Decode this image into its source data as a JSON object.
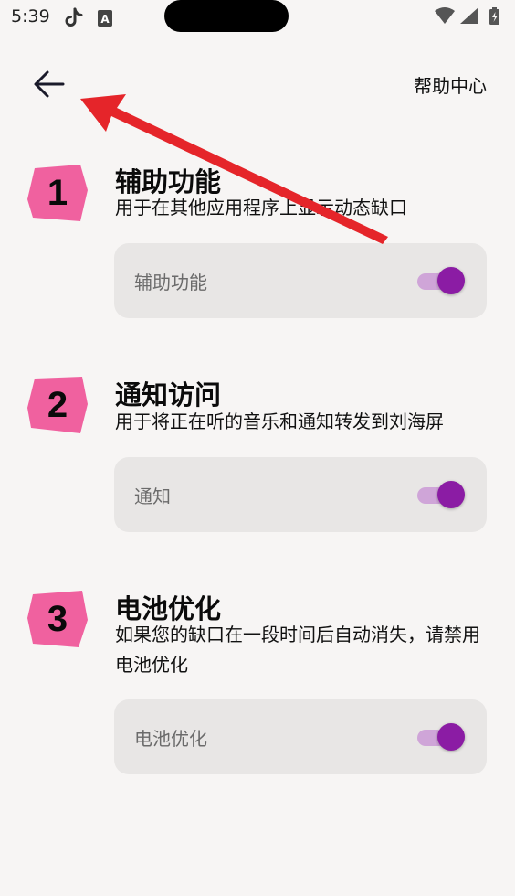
{
  "status_bar": {
    "time": "5:39",
    "icons": [
      "tiktok-icon",
      "a-box-icon",
      "wifi-icon",
      "signal-icon",
      "battery-icon"
    ]
  },
  "header": {
    "back_icon": "arrow-left-icon",
    "help_label": "帮助中心"
  },
  "steps": [
    {
      "number": "1",
      "title": "辅助功能",
      "description": "用于在其他应用程序上显示动态缺口",
      "toggle_label": "辅助功能",
      "toggle_on": true
    },
    {
      "number": "2",
      "title": "通知访问",
      "description": "用于将正在听的音乐和通知转发到刘海屏",
      "toggle_label": "通知",
      "toggle_on": true
    },
    {
      "number": "3",
      "title": "电池优化",
      "description": "如果您的缺口在一段时间后自动消失，请禁用电池优化",
      "toggle_label": "电池优化",
      "toggle_on": true
    }
  ],
  "colors": {
    "background": "#f7f5f4",
    "badge_pink": "#f0619f",
    "toggle_thumb": "#8b1ca4",
    "toggle_track": "#cfa5d8",
    "card": "#e8e6e5",
    "annotation_arrow": "#e5252a"
  }
}
